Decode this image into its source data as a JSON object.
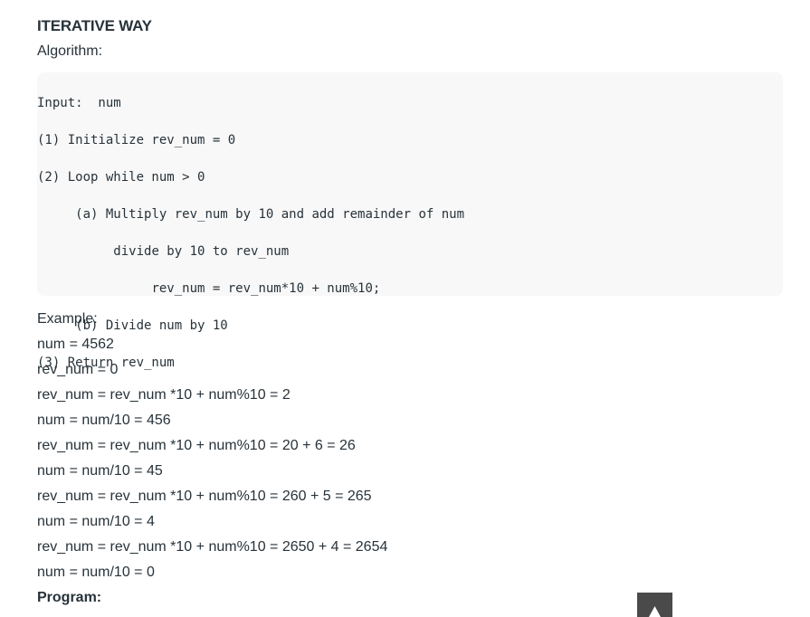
{
  "section": {
    "heading": "ITERATIVE WAY",
    "subheading": "Algorithm:"
  },
  "algorithm": {
    "lines": [
      {
        "indent": "",
        "text": "Input:  num"
      },
      {
        "indent": "",
        "text": "(1) Initialize rev_num = 0"
      },
      {
        "indent": "",
        "text": "(2) Loop while num > 0"
      },
      {
        "indent": "     ",
        "text": "(a) Multiply rev_num by 10 and add remainder of num"
      },
      {
        "indent": "          ",
        "text": "divide by 10 to rev_num"
      },
      {
        "indent": "               ",
        "text": "rev_num = rev_num*10 + num%10;"
      },
      {
        "indent": "     ",
        "text": "(b) Divide num by 10"
      },
      {
        "indent": "",
        "text": "(3) Return rev_num"
      }
    ]
  },
  "example": {
    "lines": [
      "Example:",
      "num = 4562",
      "rev_num = 0",
      "rev_num = rev_num *10 + num%10 = 2",
      "num = num/10 = 456",
      "rev_num = rev_num *10 + num%10 = 20 + 6 = 26",
      "num = num/10 = 45",
      "rev_num = rev_num *10 + num%10 = 260 + 5 = 265",
      "num = num/10 = 4",
      "rev_num = rev_num *10 + num%10 = 2650 + 4 = 2654",
      "num = num/10 = 0"
    ]
  },
  "program": {
    "label": "Program:"
  },
  "scroll_top": {
    "icon": "arrow-up-icon",
    "color": "#4a4a4a"
  }
}
